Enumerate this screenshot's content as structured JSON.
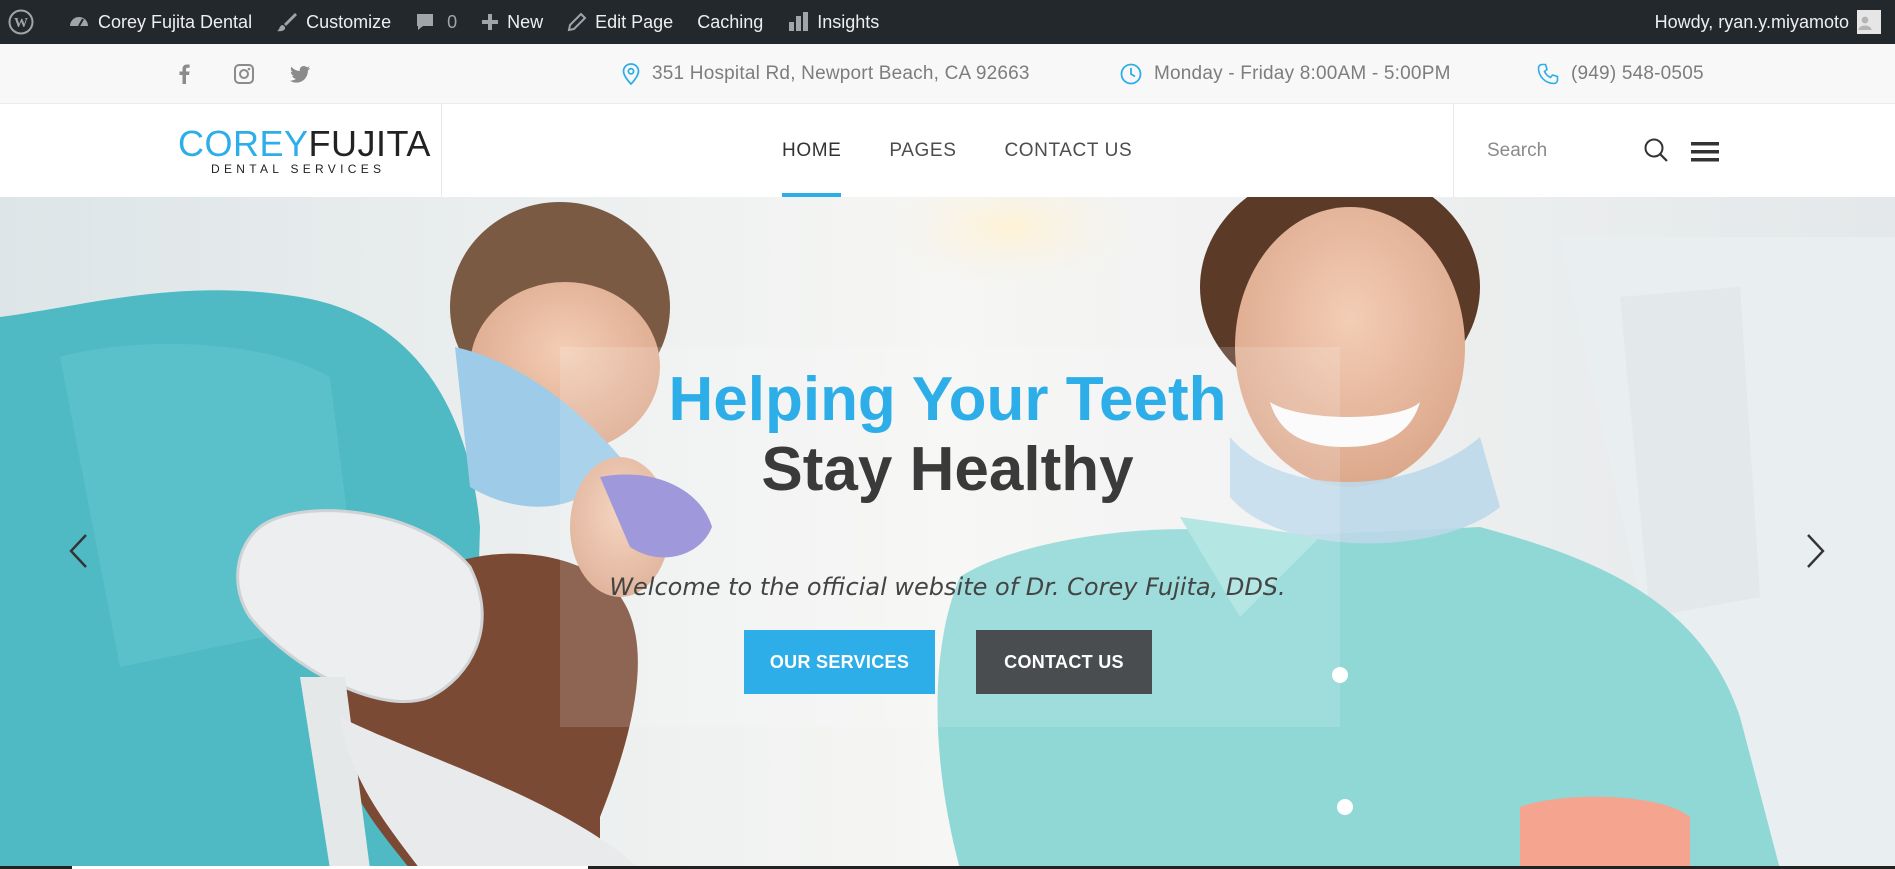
{
  "admin_bar": {
    "site_name": "Corey Fujita Dental",
    "customize": "Customize",
    "comments_count": "0",
    "new": "New",
    "edit_page": "Edit Page",
    "caching": "Caching",
    "insights": "Insights",
    "howdy": "Howdy, ryan.y.miyamoto"
  },
  "top_bar": {
    "social": [
      "facebook-icon",
      "instagram-icon",
      "twitter-icon"
    ],
    "address": "351 Hospital Rd, Newport Beach, CA 92663",
    "hours": "Monday - Friday 8:00AM - 5:00PM",
    "phone": "(949) 548-0505"
  },
  "header": {
    "logo": {
      "first": "COREY",
      "last": "FUJITA",
      "tagline": "DENTAL SERVICES"
    },
    "nav": [
      "HOME",
      "PAGES",
      "CONTACT US"
    ],
    "active_nav": "HOME",
    "search_placeholder": "Search"
  },
  "hero": {
    "title_line1": "Helping Your Teeth",
    "title_line2": "Stay Healthy",
    "subtitle": "Welcome to the official website of Dr. Corey Fujita, DDS.",
    "primary_button": "OUR SERVICES",
    "secondary_button": "CONTACT US"
  },
  "colors": {
    "accent": "#2eaee8",
    "admin_bar": "#23282d",
    "dark_button": "#4a4d50"
  }
}
